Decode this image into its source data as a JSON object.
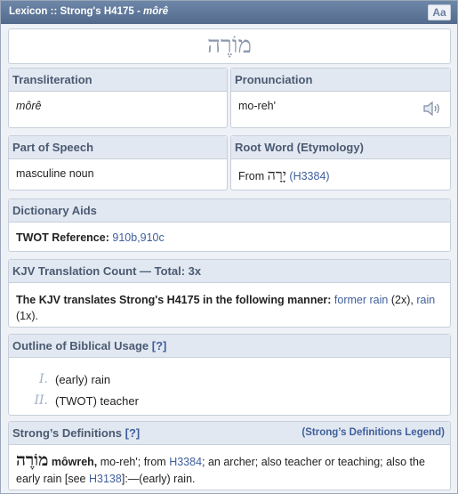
{
  "window": {
    "title_prefix": "Lexicon :: Strong's H4175 - ",
    "title_word": "môrê",
    "font_button": "Aa"
  },
  "headword": {
    "hebrew": "מוֹרֶה"
  },
  "transliteration": {
    "heading": "Transliteration",
    "value": "môrê"
  },
  "pronunciation": {
    "heading": "Pronunciation",
    "value": "mo-reh'",
    "audio_icon": "speaker-icon"
  },
  "part_of_speech": {
    "heading": "Part of Speech",
    "value": "masculine noun"
  },
  "root_word": {
    "heading": "Root Word (Etymology)",
    "from": "From",
    "hebrew": "יָרָה",
    "ref": "(H3384)"
  },
  "dictionary_aids": {
    "heading": "Dictionary Aids",
    "label": "TWOT Reference:",
    "value": "910b,910c"
  },
  "kjv": {
    "heading": "KJV Translation Count — Total: 3x",
    "lead": "The KJV translates Strong's H4175 in the following manner:",
    "item1_link": "former rain",
    "item1_count": "(2x),",
    "item2_link": "rain",
    "item2_count": "(1x)."
  },
  "outline": {
    "heading": "Outline of Biblical Usage",
    "help": "[?]",
    "items": [
      {
        "num": "I.",
        "text": "(early) rain"
      },
      {
        "num": "II.",
        "text": "(TWOT) teacher"
      }
    ]
  },
  "strongs": {
    "heading": "Strong’s Definitions",
    "help": "[?]",
    "legend": "(Strong’s Definitions Legend)",
    "hebrew": "מוֹרֶה",
    "translit": "môwreh,",
    "t1": "mo-reh'; from",
    "link1": "H3384",
    "t2": "; an archer; also teacher or teaching; also",
    "t3": "the early rain [see",
    "link2": "H3138",
    "t4": "]:—(early) rain."
  },
  "colors": {
    "title_bar": "#5f7799",
    "link": "#3f5f9b",
    "header_bg": "#e2e8f1"
  }
}
